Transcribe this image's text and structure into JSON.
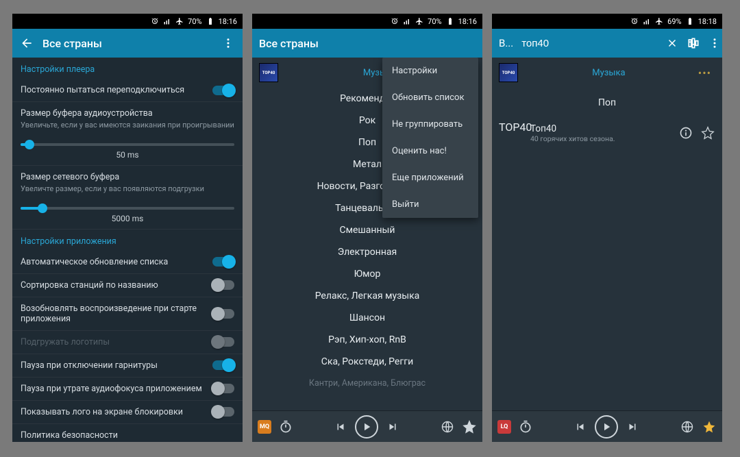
{
  "status": {
    "battery1": "70%",
    "time1": "18:16",
    "battery2": "70%",
    "time2": "18:16",
    "battery3": "69%",
    "time3": "18:18"
  },
  "pane1": {
    "title": "Все страны",
    "sect_player": "Настройки плеера",
    "reconnect": "Постоянно пытаться переподключиться",
    "buf_audio_t": "Размер буфера аудиоустройства",
    "buf_audio_s": "Увеличьте, если у вас имеются заикания при проигрывании",
    "buf_audio_v": "50 ms",
    "buf_net_t": "Размер сетевого буфера",
    "buf_net_s": "Увеличте размер, если у вас появляются подгрузки",
    "buf_net_v": "5000 ms",
    "sect_app": "Настройки приложения",
    "auto_update": "Автоматическое обновление списка",
    "sort": "Сортировка станций по названию",
    "resume": "Возобновлять воспроизведение при старте приложения",
    "logos": "Подгружать логотипы",
    "pause_hp": "Пауза при отключении гарнитуры",
    "pause_af": "Пауза при утрате аудиофокуса приложением",
    "lock_logo": "Показывать лого на экране блокировки",
    "policy": "Политика безопасности"
  },
  "pane2": {
    "title": "Все страны",
    "music_lbl": "Музыка",
    "menu": [
      "Настройки",
      "Обновить список",
      "Не группировать",
      "Оценить нас!",
      "Еще приложений",
      "Выйти"
    ],
    "genres": [
      "Рекомендуе",
      "Рок",
      "Поп",
      "Метал",
      "Новости, Разговорное",
      "Танцевальная",
      "Смешанный",
      "Электронная",
      "Юмор",
      "Релакс, Легкая музыка",
      "Шансон",
      "Рэп, Хип-хоп, RnB",
      "Ска, Рокстеди, Регги",
      "Кантри, Американа, Блюграс"
    ],
    "quality": "MQ"
  },
  "pane3": {
    "title_trunc": "В...",
    "search": "топ40",
    "music_lbl": "Музыка",
    "category": "Поп",
    "station_name": "Топ40",
    "station_desc": "40 горячих хитов сезона.",
    "quality": "LQ"
  }
}
